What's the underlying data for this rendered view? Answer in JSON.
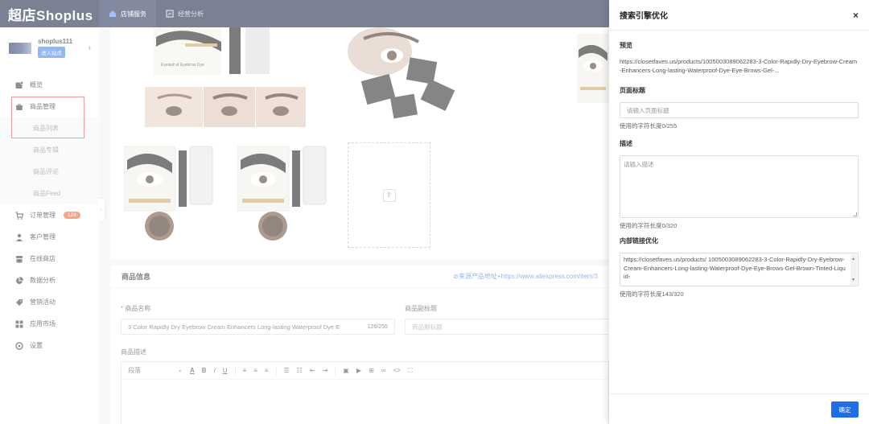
{
  "app": {
    "logo": "超店Shoplus"
  },
  "topnav": [
    {
      "label": "店铺服务",
      "icon": "home-icon",
      "active": true
    },
    {
      "label": "经营分析",
      "icon": "chart-icon",
      "active": false
    }
  ],
  "store": {
    "name": "shoplus111",
    "enter_label": "进入站点"
  },
  "sidebar": {
    "items": [
      {
        "label": "概览",
        "icon": "overview-icon"
      },
      {
        "label": "商品管理",
        "icon": "goods-icon"
      },
      {
        "label": "订单管理",
        "icon": "cart-icon",
        "badge": "128"
      },
      {
        "label": "客户管理",
        "icon": "user-icon"
      },
      {
        "label": "在线商店",
        "icon": "store-icon"
      },
      {
        "label": "数据分析",
        "icon": "pie-icon"
      },
      {
        "label": "营销活动",
        "icon": "tag-icon"
      },
      {
        "label": "应用市场",
        "icon": "apps-icon"
      },
      {
        "label": "设置",
        "icon": "settings-icon"
      }
    ],
    "sub": [
      "商品列表",
      "商品专辑",
      "商品评论",
      "商品Feed"
    ]
  },
  "main": {
    "section_title": "商品信息",
    "source_link": "⊘来源产品地址+https://www.aliexpress.com/item/3",
    "name_label": "商品名称",
    "name_value": "3 Color Rapidly Dry Eyebrow Cream Enhancers Long-lasting Waterproof Dye E",
    "name_count": "126/255",
    "subtitle_label": "商品副标题",
    "subtitle_placeholder": "商品副标题",
    "desc_label": "商品描述",
    "editor_paragraph": "段落",
    "product_text": "Eyelash & Eyebrow Dye"
  },
  "drawer": {
    "title": "搜索引擎优化",
    "close": "×",
    "preview_label": "预览",
    "preview_url": "https://closetfaves.us/products/1005003089062283-3-Color-Rapidly-Dry-Eyebrow-Cream-Enhancers-Long-lasting-Waterproof-Dye-Eye-Brows-Gel-...",
    "page_title_label": "页面标题",
    "page_title_placeholder": "请输入页面标题",
    "page_title_count": "使用的字符长度0/255",
    "desc_label": "描述",
    "desc_placeholder": "请输入描述",
    "desc_count": "使用的字符长度0/320",
    "link_label": "内部链接优化",
    "link_value": "https://closetfaves.us/products/ 1005003089062283-3-Color-Rapidly-Dry-Eyebrow-Cream-Enhancers-Long-lasting-Waterproof-Dye-Eye-Brows-Gel-Brown-Tinted-Liquid-",
    "link_count": "使用的字符长度143/320",
    "ok_label": "确定"
  }
}
